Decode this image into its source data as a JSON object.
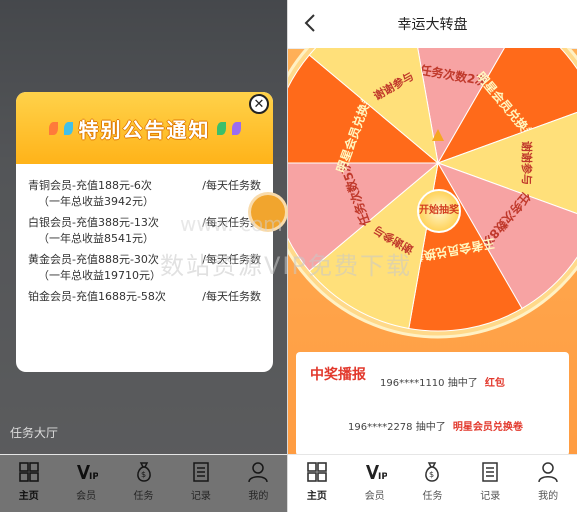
{
  "left": {
    "popup": {
      "title": "特别公告通知",
      "lines": [
        {
          "text": "青铜会员-充值188元-6次",
          "suffix": "/每天任务数"
        },
        {
          "text": "（一年总收益3942元）",
          "suffix": ""
        },
        {
          "text": "白银会员-充值388元-13次",
          "suffix": "/每天任务数"
        },
        {
          "text": "（一年总收益8541元）",
          "suffix": ""
        },
        {
          "text": "黄金会员-充值888元-30次",
          "suffix": "/每天任务数"
        },
        {
          "text": "（一年总收益19710元）",
          "suffix": ""
        },
        {
          "text": "铂金会员-充值1688元-58次",
          "suffix": "/每天任务数"
        }
      ],
      "close_icon": "close-icon"
    },
    "section_label": "任务大厅",
    "tabs": [
      {
        "label": "主页",
        "icon": "grid-icon"
      },
      {
        "label": "会员",
        "icon": "vip-icon"
      },
      {
        "label": "任务",
        "icon": "money-bag-icon"
      },
      {
        "label": "记录",
        "icon": "document-icon"
      },
      {
        "label": "我的",
        "icon": "user-icon"
      }
    ]
  },
  "right": {
    "nav_title": "幸运大转盘",
    "wheel": {
      "start_label": "开始抽奖",
      "segments": [
        "任务次数2次",
        "明星会员兑换卷",
        "谢谢参与",
        "任务次数8次",
        "王者会员兑换卷",
        "谢谢参与",
        "任务次数5次",
        "明星会员兑换卷",
        "谢谢参与"
      ]
    },
    "winners": {
      "title": "中奖播报",
      "rows": [
        {
          "user": "196****1110",
          "verb": "抽中了",
          "prize": "红包"
        },
        {
          "user": "196****2278",
          "verb": "抽中了",
          "prize": "明星会员兑换卷"
        }
      ]
    },
    "tabs": [
      {
        "label": "主页",
        "icon": "grid-icon"
      },
      {
        "label": "会员",
        "icon": "vip-icon"
      },
      {
        "label": "任务",
        "icon": "money-bag-icon"
      },
      {
        "label": "记录",
        "icon": "document-icon"
      },
      {
        "label": "我的",
        "icon": "user-icon"
      }
    ]
  },
  "watermark": {
    "text": "数站资源VIP免费下载",
    "url": "www.   com"
  },
  "colors": {
    "popup_header": "#ffb319",
    "accent_red": "#e2382c",
    "wheel_orange": "#ff6a1a",
    "wheel_pink": "#f7a3a3",
    "wheel_yellow": "#ffe07a"
  }
}
